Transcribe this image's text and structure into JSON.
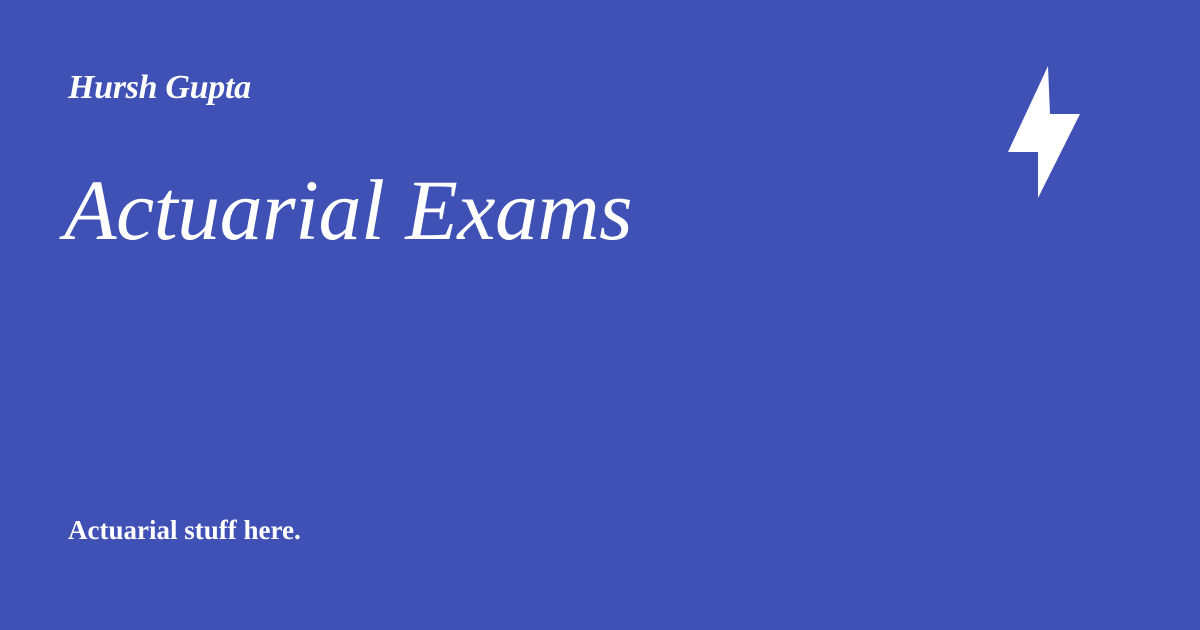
{
  "card": {
    "author": "Hursh Gupta",
    "title": "Actuarial Exams",
    "description": "Actuarial stuff here.",
    "logo_icon": "lightning-bolt-icon",
    "background_color": "#3f51b5",
    "text_color": "#ffffff"
  }
}
